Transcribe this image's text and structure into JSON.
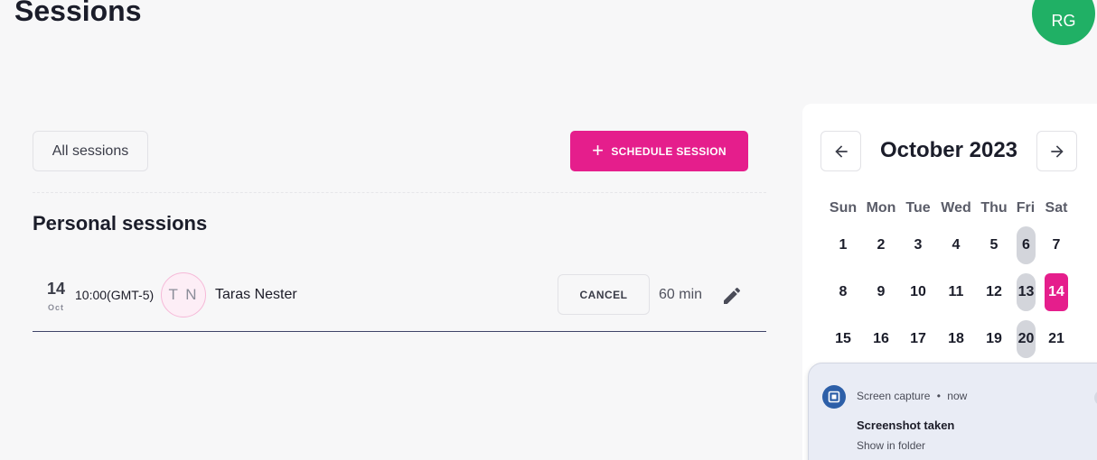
{
  "header": {
    "title": "Sessions",
    "user_initials": "RG"
  },
  "toolbar": {
    "filter_label": "All sessions",
    "schedule_label": "SCHEDULE SESSION",
    "schedule_icon": "+"
  },
  "section": {
    "title": "Personal sessions"
  },
  "sessions": [
    {
      "day": "14",
      "month": "Oct",
      "time": "10:00(GMT-5)",
      "initials": "T N",
      "name": "Taras Nester",
      "cancel_label": "CANCEL",
      "duration": "60 min"
    }
  ],
  "calendar": {
    "title": "October 2023",
    "prev_icon": "arrow-left-icon",
    "next_icon": "arrow-right-icon",
    "weekdays": [
      "Sun",
      "Mon",
      "Tue",
      "Wed",
      "Thu",
      "Fri",
      "Sat"
    ],
    "weeks": [
      [
        "1",
        "2",
        "3",
        "4",
        "5",
        "6",
        "7"
      ],
      [
        "8",
        "9",
        "10",
        "11",
        "12",
        "13",
        "14"
      ],
      [
        "15",
        "16",
        "17",
        "18",
        "19",
        "20",
        "21"
      ]
    ],
    "selected_day": "14"
  },
  "notification": {
    "source": "Screen capture",
    "separator": "•",
    "time": "now",
    "title": "Screenshot taken",
    "subtitle": "Show in folder"
  },
  "colors": {
    "accent": "#e51e8c",
    "avatar": "#20b065",
    "highlight": "#d3d5db"
  }
}
